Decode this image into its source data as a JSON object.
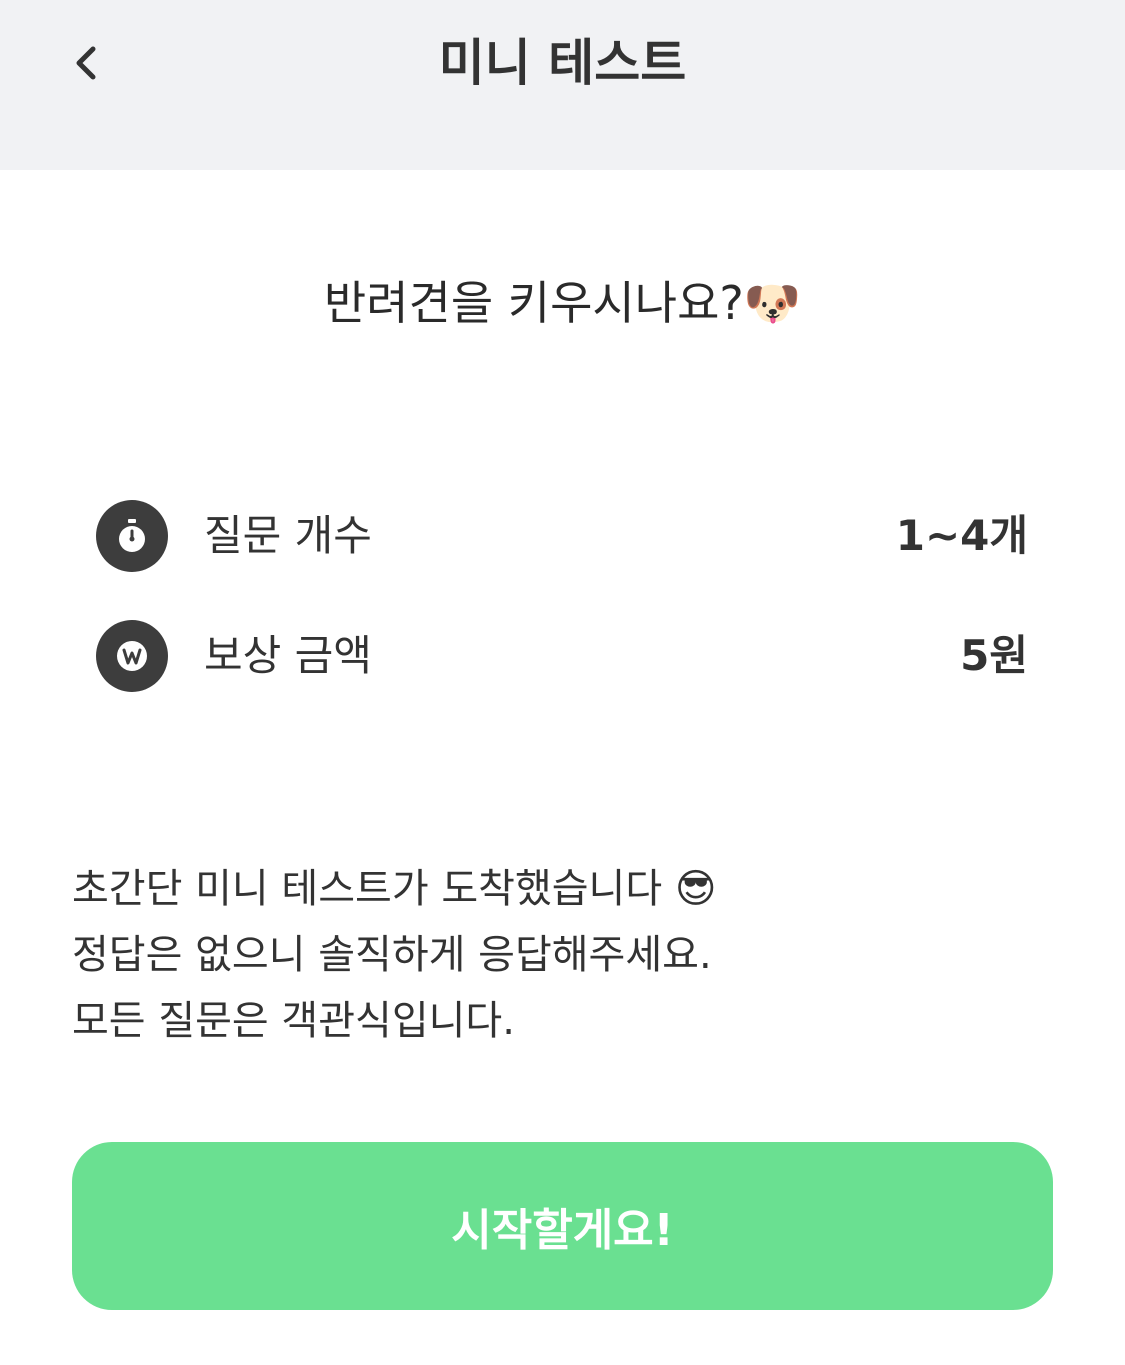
{
  "header": {
    "title": "미니 테스트",
    "back_icon": "chevron-left-icon"
  },
  "question": {
    "text": "반려견을 키우시나요?",
    "emoji": "🐶"
  },
  "info": [
    {
      "icon": "stopwatch-icon",
      "label": "질문 개수",
      "value": "1~4개"
    },
    {
      "icon": "won-coin-icon",
      "label": "보상 금액",
      "value": "5원"
    }
  ],
  "description": {
    "line1": "초간단 미니 테스트가 도착했습니다",
    "line1_emoji": "😎",
    "line2": "정답은 없으니 솔직하게 응답해주세요.",
    "line3": "모든 질문은 객관식입니다."
  },
  "start_button": {
    "label": "시작할게요!"
  },
  "colors": {
    "header_bg": "#f1f2f4",
    "button_bg": "#6ae091",
    "icon_bg": "#3d3d3d"
  }
}
